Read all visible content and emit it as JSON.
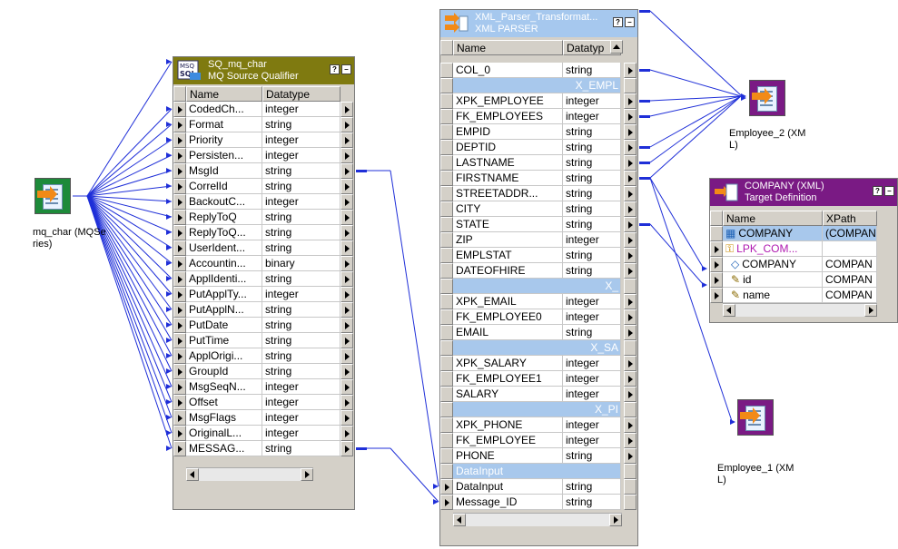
{
  "colors": {
    "wire": "#1f2fd8",
    "sq_header": "#7f7a10",
    "xml_header": "#a6c8ee",
    "target_header": "#7a1a84",
    "source_node": "#1d8a3a",
    "target_node": "#7a1a84"
  },
  "source": {
    "label": "mq_char (MQSe\nries)",
    "icon": "mq-source-icon"
  },
  "sq": {
    "title": "SQ_mq_char",
    "subtitle": "MQ Source Qualifier",
    "col_name": "Name",
    "col_type": "Datatype",
    "rows": [
      {
        "name": "CodedCh...",
        "type": "integer"
      },
      {
        "name": "Format",
        "type": "string"
      },
      {
        "name": "Priority",
        "type": "integer"
      },
      {
        "name": "Persisten...",
        "type": "integer"
      },
      {
        "name": "MsgId",
        "type": "string"
      },
      {
        "name": "CorrelId",
        "type": "string"
      },
      {
        "name": "BackoutC...",
        "type": "integer"
      },
      {
        "name": "ReplyToQ",
        "type": "string"
      },
      {
        "name": "ReplyToQ...",
        "type": "string"
      },
      {
        "name": "UserIdent...",
        "type": "string"
      },
      {
        "name": "Accountin...",
        "type": "binary"
      },
      {
        "name": "ApplIdenti...",
        "type": "string"
      },
      {
        "name": "PutApplTy...",
        "type": "integer"
      },
      {
        "name": "PutApplN...",
        "type": "string"
      },
      {
        "name": "PutDate",
        "type": "string"
      },
      {
        "name": "PutTime",
        "type": "string"
      },
      {
        "name": "ApplOrigi...",
        "type": "string"
      },
      {
        "name": "GroupId",
        "type": "string"
      },
      {
        "name": "MsgSeqN...",
        "type": "integer"
      },
      {
        "name": "Offset",
        "type": "integer"
      },
      {
        "name": "MsgFlags",
        "type": "integer"
      },
      {
        "name": "OriginalL...",
        "type": "integer"
      },
      {
        "name": "MESSAG...",
        "type": "string"
      }
    ]
  },
  "parser": {
    "title": "XML_Parser_Transformat...",
    "subtitle": "XML PARSER",
    "col_name": "Name",
    "col_type": "Datatyp",
    "rows": [
      {
        "name": "COL_0",
        "type": "string",
        "kind": "row"
      },
      {
        "name": "",
        "type": "X_EMPL",
        "kind": "group"
      },
      {
        "name": "XPK_EMPLOYEE",
        "type": "integer",
        "kind": "row"
      },
      {
        "name": "FK_EMPLOYEES",
        "type": "integer",
        "kind": "row"
      },
      {
        "name": "EMPID",
        "type": "string",
        "kind": "row"
      },
      {
        "name": "DEPTID",
        "type": "string",
        "kind": "row"
      },
      {
        "name": "LASTNAME",
        "type": "string",
        "kind": "row"
      },
      {
        "name": "FIRSTNAME",
        "type": "string",
        "kind": "row"
      },
      {
        "name": "STREETADDR...",
        "type": "string",
        "kind": "row"
      },
      {
        "name": "CITY",
        "type": "string",
        "kind": "row"
      },
      {
        "name": "STATE",
        "type": "string",
        "kind": "row"
      },
      {
        "name": "ZIP",
        "type": "integer",
        "kind": "row"
      },
      {
        "name": "EMPLSTAT",
        "type": "string",
        "kind": "row"
      },
      {
        "name": "DATEOFHIRE",
        "type": "string",
        "kind": "row"
      },
      {
        "name": "",
        "type": "X_",
        "kind": "group"
      },
      {
        "name": "XPK_EMAIL",
        "type": "integer",
        "kind": "row"
      },
      {
        "name": "FK_EMPLOYEE0",
        "type": "integer",
        "kind": "row"
      },
      {
        "name": "EMAIL",
        "type": "string",
        "kind": "row"
      },
      {
        "name": "",
        "type": "X_SA",
        "kind": "group"
      },
      {
        "name": "XPK_SALARY",
        "type": "integer",
        "kind": "row"
      },
      {
        "name": "FK_EMPLOYEE1",
        "type": "integer",
        "kind": "row"
      },
      {
        "name": "SALARY",
        "type": "integer",
        "kind": "row"
      },
      {
        "name": "",
        "type": "X_PI",
        "kind": "group"
      },
      {
        "name": "XPK_PHONE",
        "type": "integer",
        "kind": "row"
      },
      {
        "name": "FK_EMPLOYEE",
        "type": "integer",
        "kind": "row"
      },
      {
        "name": "PHONE",
        "type": "string",
        "kind": "row"
      },
      {
        "name": "DataInput",
        "type": "",
        "kind": "group"
      },
      {
        "name": "DataInput",
        "type": "string",
        "kind": "row"
      },
      {
        "name": "Message_ID",
        "type": "string",
        "kind": "row"
      }
    ]
  },
  "emp2": {
    "label": "Employee_2 (XM\nL)",
    "icon": "xml-target-icon"
  },
  "emp1": {
    "label": "Employee_1 (XM\nL)",
    "icon": "xml-target-icon"
  },
  "company": {
    "title": "COMPANY (XML)",
    "subtitle": "Target Definition",
    "col_name": "Name",
    "col_xpath": "XPath",
    "rows": [
      {
        "name": "COMPANY",
        "xpath": "(COMPAN",
        "icon": "table-icon"
      },
      {
        "name": "LPK_COM...",
        "xpath": "",
        "icon": "key-icon"
      },
      {
        "name": "COMPANY",
        "xpath": "COMPAN",
        "icon": "element-icon"
      },
      {
        "name": "id",
        "xpath": "COMPAN",
        "icon": "attribute-icon"
      },
      {
        "name": "name",
        "xpath": "COMPAN",
        "icon": "attribute-icon"
      }
    ]
  }
}
